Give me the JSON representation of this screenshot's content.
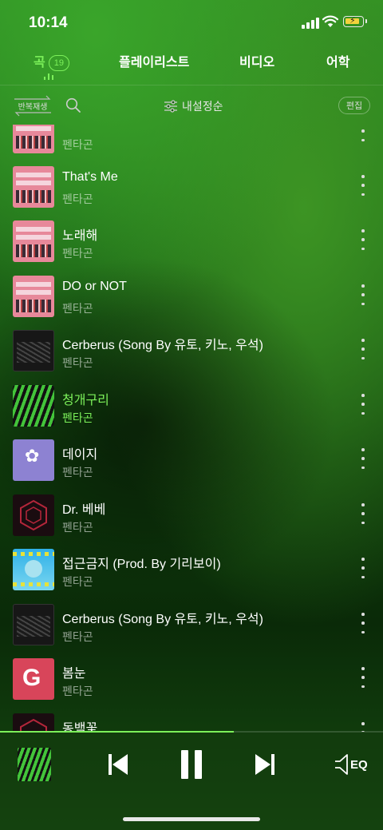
{
  "status_bar": {
    "time": "10:14"
  },
  "tabs": [
    {
      "label": "곡",
      "count": "19",
      "active": true
    },
    {
      "label": "플레이리스트"
    },
    {
      "label": "비디오"
    },
    {
      "label": "어학"
    }
  ],
  "toolbar": {
    "repeat_label": "반복재생",
    "sort_label": "내설정순",
    "edit_label": "편집"
  },
  "songs": [
    {
      "title": "",
      "artist": "펜타곤",
      "art": "pink"
    },
    {
      "title": "That's Me",
      "artist": "펜타곤",
      "art": "pink"
    },
    {
      "title": "노래해",
      "artist": "펜타곤",
      "art": "pink"
    },
    {
      "title": "DO or NOT",
      "artist": "펜타곤",
      "art": "pink"
    },
    {
      "title": "Cerberus (Song By 유토, 키노, 우석)",
      "artist": "펜타곤",
      "art": "dark"
    },
    {
      "title": "청개구리",
      "artist": "펜타곤",
      "art": "green",
      "now_playing": true
    },
    {
      "title": "데이지",
      "artist": "펜타곤",
      "art": "purple"
    },
    {
      "title": "Dr. 베베",
      "artist": "펜타곤",
      "art": "hex"
    },
    {
      "title": "접근금지 (Prod. By 기리보이)",
      "artist": "펜타곤",
      "art": "aqua"
    },
    {
      "title": "Cerberus (Song By 유토, 키노, 우석)",
      "artist": "펜타곤",
      "art": "dark"
    },
    {
      "title": "봄눈",
      "artist": "펜타곤",
      "art": "red"
    },
    {
      "title": "동백꽃",
      "artist": "",
      "art": "hex"
    }
  ],
  "player": {
    "progress": 0.61,
    "eq_label": "EQ"
  },
  "colors": {
    "accent": "#7cf05a",
    "background": "#1f6a18"
  },
  "icons": [
    "search-icon",
    "sort-icon",
    "more-icon",
    "previous-icon",
    "pause-icon",
    "next-icon",
    "speaker-icon",
    "repeat-icon"
  ]
}
